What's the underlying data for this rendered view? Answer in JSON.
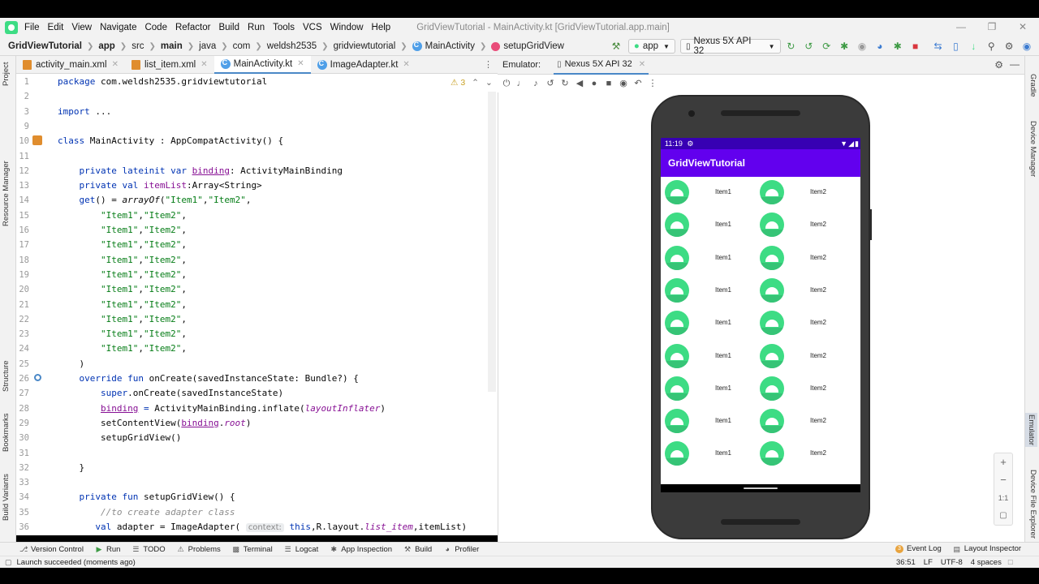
{
  "menubar": {
    "items": [
      "File",
      "Edit",
      "View",
      "Navigate",
      "Code",
      "Refactor",
      "Build",
      "Run",
      "Tools",
      "VCS",
      "Window",
      "Help"
    ],
    "window_title": "GridViewTutorial - MainActivity.kt [GridViewTutorial.app.main]"
  },
  "navbar": {
    "crumbs": [
      "GridViewTutorial",
      "app",
      "src",
      "main",
      "java",
      "com",
      "weldsh2535",
      "gridviewtutorial",
      "MainActivity",
      "setupGridView"
    ],
    "run_config": "app",
    "device": "Nexus 5X API 32"
  },
  "tabs": [
    {
      "label": "activity_main.xml"
    },
    {
      "label": "list_item.xml"
    },
    {
      "label": "MainActivity.kt"
    },
    {
      "label": "ImageAdapter.kt"
    }
  ],
  "editor": {
    "warnings": "⚠ 3",
    "lines": [
      {
        "n": "1",
        "segs": [
          [
            "kw",
            "package "
          ],
          [
            "",
            "com.weldsh2535.gridviewtutorial"
          ]
        ]
      },
      {
        "n": "2",
        "segs": []
      },
      {
        "n": "3",
        "segs": [
          [
            "kw",
            "import "
          ],
          [
            "",
            "..."
          ]
        ]
      },
      {
        "n": "9",
        "segs": []
      },
      {
        "n": "10",
        "segs": [
          [
            "kw",
            "class "
          ],
          [
            "",
            "MainActivity : AppCompatActivity() {"
          ]
        ]
      },
      {
        "n": "11",
        "segs": []
      },
      {
        "n": "12",
        "segs": [
          [
            "",
            "    "
          ],
          [
            "kw",
            "private lateinit var "
          ],
          [
            "fld ul",
            "binding"
          ],
          [
            "",
            ": ActivityMainBinding"
          ]
        ]
      },
      {
        "n": "13",
        "segs": [
          [
            "",
            "    "
          ],
          [
            "kw",
            "private val "
          ],
          [
            "fld",
            "itemList"
          ],
          [
            "",
            ":Array<String>"
          ]
        ]
      },
      {
        "n": "14",
        "segs": [
          [
            "",
            "    "
          ],
          [
            "kw",
            "get"
          ],
          [
            "",
            "() = "
          ],
          [
            "it",
            "arrayOf"
          ],
          [
            "",
            "("
          ],
          [
            "str",
            "\"Item1\""
          ],
          [
            "",
            ","
          ],
          [
            "str",
            "\"Item2\""
          ],
          [
            "",
            ","
          ]
        ]
      },
      {
        "n": "15",
        "segs": [
          [
            "",
            "        "
          ],
          [
            "str",
            "\"Item1\""
          ],
          [
            "",
            ","
          ],
          [
            "str",
            "\"Item2\""
          ],
          [
            "",
            ","
          ]
        ]
      },
      {
        "n": "16",
        "segs": [
          [
            "",
            "        "
          ],
          [
            "str",
            "\"Item1\""
          ],
          [
            "",
            ","
          ],
          [
            "str",
            "\"Item2\""
          ],
          [
            "",
            ","
          ]
        ]
      },
      {
        "n": "17",
        "segs": [
          [
            "",
            "        "
          ],
          [
            "str",
            "\"Item1\""
          ],
          [
            "",
            ","
          ],
          [
            "str",
            "\"Item2\""
          ],
          [
            "",
            ","
          ]
        ]
      },
      {
        "n": "18",
        "segs": [
          [
            "",
            "        "
          ],
          [
            "str",
            "\"Item1\""
          ],
          [
            "",
            ","
          ],
          [
            "str",
            "\"Item2\""
          ],
          [
            "",
            ","
          ]
        ]
      },
      {
        "n": "19",
        "segs": [
          [
            "",
            "        "
          ],
          [
            "str",
            "\"Item1\""
          ],
          [
            "",
            ","
          ],
          [
            "str",
            "\"Item2\""
          ],
          [
            "",
            ","
          ]
        ]
      },
      {
        "n": "20",
        "segs": [
          [
            "",
            "        "
          ],
          [
            "str",
            "\"Item1\""
          ],
          [
            "",
            ","
          ],
          [
            "str",
            "\"Item2\""
          ],
          [
            "",
            ","
          ]
        ]
      },
      {
        "n": "21",
        "segs": [
          [
            "",
            "        "
          ],
          [
            "str",
            "\"Item1\""
          ],
          [
            "",
            ","
          ],
          [
            "str",
            "\"Item2\""
          ],
          [
            "",
            ","
          ]
        ]
      },
      {
        "n": "22",
        "segs": [
          [
            "",
            "        "
          ],
          [
            "str",
            "\"Item1\""
          ],
          [
            "",
            ","
          ],
          [
            "str",
            "\"Item2\""
          ],
          [
            "",
            ","
          ]
        ]
      },
      {
        "n": "23",
        "segs": [
          [
            "",
            "        "
          ],
          [
            "str",
            "\"Item1\""
          ],
          [
            "",
            ","
          ],
          [
            "str",
            "\"Item2\""
          ],
          [
            "",
            ","
          ]
        ]
      },
      {
        "n": "24",
        "segs": [
          [
            "",
            "        "
          ],
          [
            "str",
            "\"Item1\""
          ],
          [
            "",
            ","
          ],
          [
            "str",
            "\"Item2\""
          ],
          [
            "",
            ","
          ]
        ]
      },
      {
        "n": "25",
        "segs": [
          [
            "",
            "    )"
          ]
        ]
      },
      {
        "n": "26",
        "segs": [
          [
            "",
            "    "
          ],
          [
            "kw",
            "override fun "
          ],
          [
            "",
            "onCreate(savedInstanceState: Bundle?) {"
          ]
        ]
      },
      {
        "n": "27",
        "segs": [
          [
            "",
            "        "
          ],
          [
            "kw",
            "super"
          ],
          [
            "",
            ".onCreate(savedInstanceState)"
          ]
        ]
      },
      {
        "n": "28",
        "segs": [
          [
            "",
            "        "
          ],
          [
            "fld ul",
            "binding"
          ],
          [
            "kw",
            " = "
          ],
          [
            "",
            "ActivityMainBinding.inflate("
          ],
          [
            "fld it",
            "layoutInflater"
          ],
          [
            "",
            ")"
          ]
        ]
      },
      {
        "n": "29",
        "segs": [
          [
            "",
            "        setContentView("
          ],
          [
            "fld ul",
            "binding"
          ],
          [
            "",
            "."
          ],
          [
            "fld it",
            "root"
          ],
          [
            "",
            ")"
          ]
        ]
      },
      {
        "n": "30",
        "segs": [
          [
            "",
            "        setupGridView()"
          ]
        ]
      },
      {
        "n": "31",
        "segs": []
      },
      {
        "n": "32",
        "segs": [
          [
            "",
            "    }"
          ]
        ]
      },
      {
        "n": "33",
        "segs": []
      },
      {
        "n": "34",
        "segs": [
          [
            "",
            "    "
          ],
          [
            "kw",
            "private fun "
          ],
          [
            "",
            "setupGridView() {"
          ]
        ]
      },
      {
        "n": "35",
        "segs": [
          [
            "",
            "        "
          ],
          [
            "cm",
            "//to create adapter class"
          ]
        ]
      },
      {
        "n": "36",
        "segs": [
          [
            "",
            "       "
          ],
          [
            "kw",
            "val "
          ],
          [
            "",
            "adapter = ImageAdapter( "
          ],
          [
            "hint",
            "context:"
          ],
          [
            "",
            " "
          ],
          [
            "kw",
            "this"
          ],
          [
            "",
            ",R.layout."
          ],
          [
            "fld it",
            "list_item"
          ],
          [
            "",
            ",itemList)"
          ]
        ]
      }
    ]
  },
  "left_tools": [
    "Project",
    "Resource Manager",
    "Structure",
    "Bookmarks",
    "Build Variants"
  ],
  "right_tools": [
    "Gradle",
    "Device Manager",
    "Emulator",
    "Device File Explorer"
  ],
  "emulator": {
    "label": "Emulator:",
    "tab": "Nexus 5X API 32"
  },
  "phone": {
    "time": "11:19",
    "app_title": "GridViewTutorial",
    "items": [
      "Item1",
      "Item2",
      "Item1",
      "Item2",
      "Item1",
      "Item2",
      "Item1",
      "Item2",
      "Item1",
      "Item2",
      "Item1",
      "Item2",
      "Item1",
      "Item2",
      "Item1",
      "Item2",
      "Item1",
      "Item2"
    ]
  },
  "bottom_tools": [
    "Version Control",
    "Run",
    "TODO",
    "Problems",
    "Terminal",
    "Logcat",
    "App Inspection",
    "Build",
    "Profiler"
  ],
  "bottom_right_tools": [
    "Event Log",
    "Layout Inspector"
  ],
  "event_count": "3",
  "status": {
    "message": "Launch succeeded (moments ago)",
    "position": "36:51",
    "line_sep": "LF",
    "encoding": "UTF-8",
    "indent": "4 spaces"
  }
}
